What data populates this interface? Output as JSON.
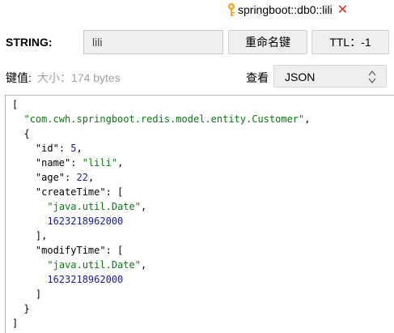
{
  "tab": {
    "title": "springboot::db0::lili",
    "icon": "key-icon",
    "close_icon": "close-icon"
  },
  "key_row": {
    "type_label": "STRING:",
    "key_value": "lili",
    "rename_label": "重命名键",
    "ttl_label": "TTL：-1"
  },
  "value_row": {
    "value_label": "键值:",
    "size_text": "大小：174 bytes",
    "view_label": "查看",
    "view_mode": "JSON"
  },
  "json_value": {
    "class_name": "com.cwh.springboot.redis.model.entity.Customer",
    "id": 5,
    "name": "lili",
    "age": 22,
    "date_class": "java.util.Date",
    "createTime": 1623218962000,
    "modifyTime": 1623218962000
  },
  "colors": {
    "string": "#0b7a12",
    "number": "#1a1aa6",
    "close": "#d93025",
    "key_icon": "#f5a623"
  }
}
